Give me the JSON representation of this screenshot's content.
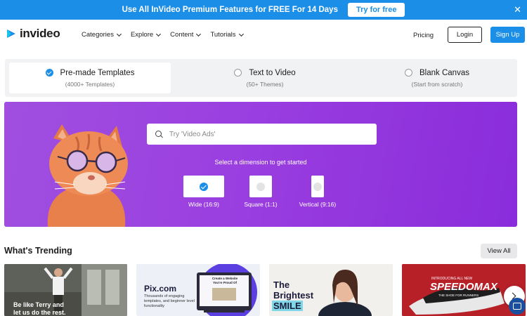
{
  "promo": {
    "text": "Use All InVideo Premium Features for FREE For 14 Days",
    "button": "Try for free",
    "close_icon": "close-icon"
  },
  "nav": {
    "brand": "invideo",
    "menu": [
      {
        "label": "Categories"
      },
      {
        "label": "Explore"
      },
      {
        "label": "Content"
      },
      {
        "label": "Tutorials"
      }
    ],
    "pricing": "Pricing",
    "login": "Login",
    "signup": "Sign Up"
  },
  "selector": {
    "options": [
      {
        "title": "Pre-made Templates",
        "subtitle": "(4000+ Templates)",
        "selected": true
      },
      {
        "title": "Text to Video",
        "subtitle": "(50+ Themes)",
        "selected": false
      },
      {
        "title": "Blank Canvas",
        "subtitle": "(Start from scratch)",
        "selected": false
      }
    ]
  },
  "hero": {
    "search_placeholder": "Try 'Video Ads'",
    "dimension_label": "Select a dimension to get started",
    "dimensions": [
      {
        "label": "Wide (16:9)",
        "selected": true
      },
      {
        "label": "Square (1:1)",
        "selected": false
      },
      {
        "label": "Vertical (9:16)",
        "selected": false
      }
    ]
  },
  "trending": {
    "title": "What's Trending",
    "view_all": "View All",
    "cards": [
      {
        "line1": "Be like Terry and",
        "line2": "let us do the rest."
      },
      {
        "brand": "Pix.com",
        "body": "Thousands of engaging templates, and beginner level functionality",
        "screen": "Create a Website You're Proud Of"
      },
      {
        "line1": "The",
        "line2": "Brightest",
        "line3": "SMILE"
      },
      {
        "line1": "INTRODUCING ALL NEW",
        "line2": "SPEEDOMAX",
        "line3": "THE SHOE FOR RUNNERS"
      }
    ]
  },
  "colors": {
    "accent": "#1b8ee8",
    "hero_purple": "#9a3fe0",
    "selector_bg": "#f1f2f4"
  }
}
